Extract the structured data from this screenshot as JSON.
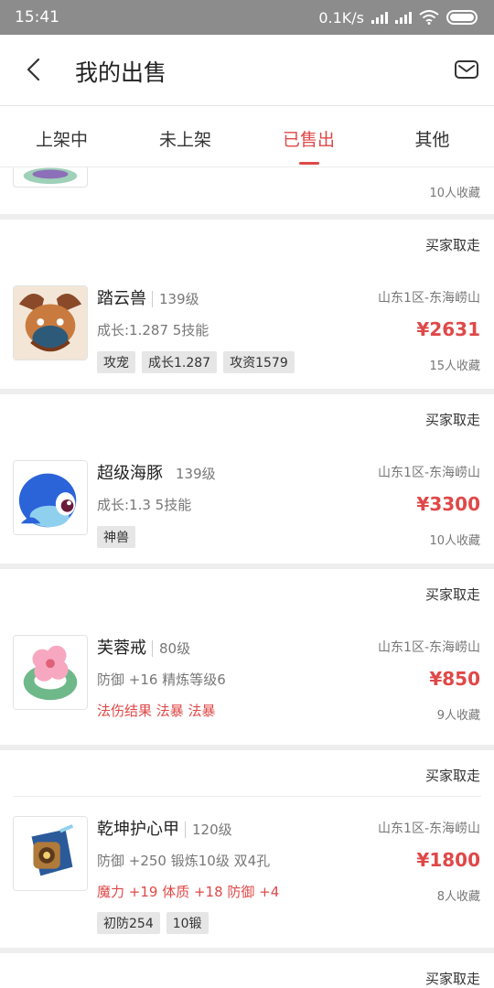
{
  "status_bar": {
    "time": "15:41",
    "speed": "0.1K/s"
  },
  "header": {
    "title": "我的出售"
  },
  "tabs": [
    {
      "label": "上架中"
    },
    {
      "label": "未上架"
    },
    {
      "label": "已售出"
    },
    {
      "label": "其他"
    }
  ],
  "partial_card": {
    "favorites": "10人收藏"
  },
  "items": [
    {
      "status": "买家取走",
      "name": "踏云兽",
      "level": "139级",
      "server": "山东1区-东海崂山",
      "desc": "成长:1.287 5技能",
      "price": "¥2631",
      "favorites": "15人收藏",
      "tags": [
        "攻宠",
        "成长1.287",
        "攻资1579"
      ]
    },
    {
      "status": "买家取走",
      "name": "超级海豚",
      "level": "139级",
      "server": "山东1区-东海崂山",
      "desc": "成长:1.3 5技能",
      "price": "¥3300",
      "favorites": "10人收藏",
      "tags": [
        "神兽"
      ]
    },
    {
      "status": "买家取走",
      "name": "芙蓉戒",
      "level": "80级",
      "server": "山东1区-东海崂山",
      "desc": "防御 +16 精炼等级6",
      "extra": "法伤结果 法暴 法暴",
      "price": "¥850",
      "favorites": "9人收藏"
    },
    {
      "status": "买家取走",
      "name": "乾坤护心甲",
      "level": "120级",
      "server": "山东1区-东海崂山",
      "desc": "防御 +250 锻炼10级 双4孔",
      "extra": "魔力 +19 体质 +18 防御 +4",
      "price": "¥1800",
      "favorites": "8人收藏",
      "tags": [
        "初防254",
        "10锻"
      ]
    }
  ],
  "next_card": {
    "status": "买家取走"
  }
}
